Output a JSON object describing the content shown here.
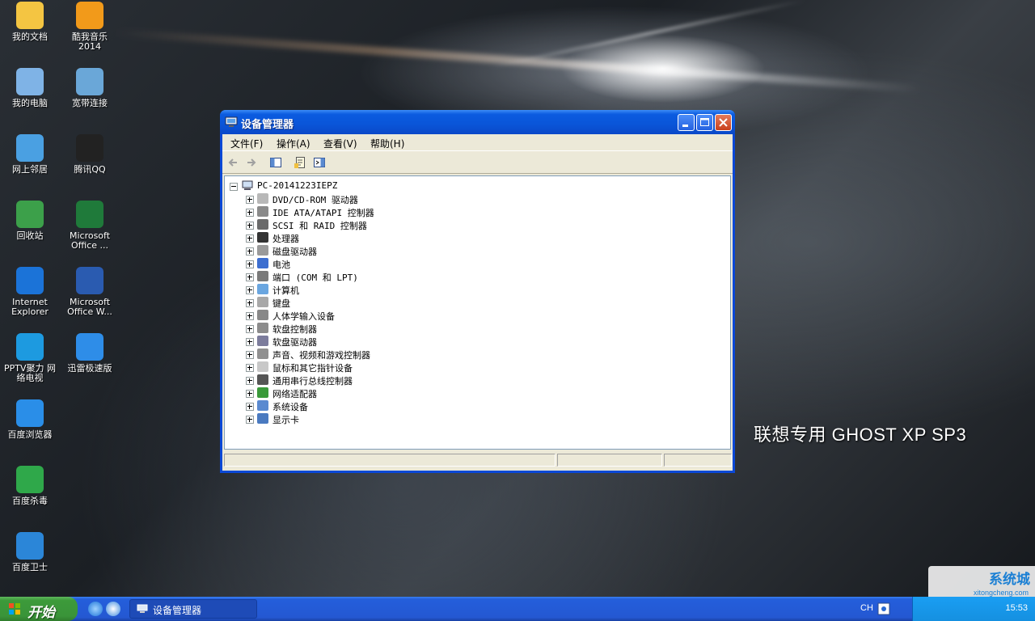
{
  "desktop": {
    "icons": [
      {
        "label": "我的文档",
        "icon": "my-documents-icon",
        "color": "#f4c542"
      },
      {
        "label": "酷我音乐\n2014",
        "icon": "kuwo-music-icon",
        "color": "#f29a1a"
      },
      {
        "label": "我的电脑",
        "icon": "my-computer-icon",
        "color": "#7fb3e6"
      },
      {
        "label": "宽带连接",
        "icon": "broadband-icon",
        "color": "#6aa7d8"
      },
      {
        "label": "网上邻居",
        "icon": "network-places-icon",
        "color": "#4aa0e2"
      },
      {
        "label": "腾讯QQ",
        "icon": "qq-icon",
        "color": "#222222"
      },
      {
        "label": "回收站",
        "icon": "recycle-bin-icon",
        "color": "#3ca04a"
      },
      {
        "label": "Microsoft\nOffice ...",
        "icon": "excel-icon",
        "color": "#1f7a3a"
      },
      {
        "label": "Internet\nExplorer",
        "icon": "ie-icon",
        "color": "#1b73d8"
      },
      {
        "label": "Microsoft\nOffice W...",
        "icon": "word-icon",
        "color": "#2a5bb0"
      },
      {
        "label": "PPTV聚力 网\n络电视",
        "icon": "pptv-icon",
        "color": "#1d9ae0"
      },
      {
        "label": "迅雷极速版",
        "icon": "thunder-icon",
        "color": "#2e8de8"
      },
      {
        "label": "百度浏览器",
        "icon": "baidu-browser-icon",
        "color": "#2a8ee8"
      },
      {
        "label": "百度杀毒",
        "icon": "baidu-antivirus-icon",
        "color": "#2fa84a"
      },
      {
        "label": "百度卫士",
        "icon": "baidu-guard-icon",
        "color": "#2b86d8"
      }
    ],
    "brand_text": "联想专用 GHOST XP SP3",
    "watermark": {
      "line1": "系统城",
      "line2": "xitongcheng.com"
    }
  },
  "window": {
    "title": "设备管理器",
    "menu": [
      "文件(F)",
      "操作(A)",
      "查看(V)",
      "帮助(H)"
    ],
    "root": "PC-20141223IEPZ",
    "devices": [
      {
        "label": "DVD/CD-ROM 驱动器",
        "icon": "dvd-drive-icon",
        "color": "#b8b8b8"
      },
      {
        "label": "IDE ATA/ATAPI 控制器",
        "icon": "ide-controller-icon",
        "color": "#8a8a8a"
      },
      {
        "label": "SCSI 和 RAID 控制器",
        "icon": "scsi-controller-icon",
        "color": "#6a6a6a"
      },
      {
        "label": "处理器",
        "icon": "processor-icon",
        "color": "#333333"
      },
      {
        "label": "磁盘驱动器",
        "icon": "disk-drive-icon",
        "color": "#9a9a9a"
      },
      {
        "label": "电池",
        "icon": "battery-icon",
        "color": "#3c6ed0"
      },
      {
        "label": "端口 (COM 和 LPT)",
        "icon": "port-icon",
        "color": "#7a7a7a"
      },
      {
        "label": "计算机",
        "icon": "computer-icon",
        "color": "#6aa6e0"
      },
      {
        "label": "键盘",
        "icon": "keyboard-icon",
        "color": "#a8a8a8"
      },
      {
        "label": "人体学输入设备",
        "icon": "hid-icon",
        "color": "#888888"
      },
      {
        "label": "软盘控制器",
        "icon": "floppy-controller-icon",
        "color": "#8c8c8c"
      },
      {
        "label": "软盘驱动器",
        "icon": "floppy-drive-icon",
        "color": "#7c7c9c"
      },
      {
        "label": "声音、视频和游戏控制器",
        "icon": "sound-icon",
        "color": "#909090"
      },
      {
        "label": "鼠标和其它指针设备",
        "icon": "mouse-icon",
        "color": "#c8c8c8"
      },
      {
        "label": "通用串行总线控制器",
        "icon": "usb-icon",
        "color": "#555555"
      },
      {
        "label": "网络适配器",
        "icon": "network-adapter-icon",
        "color": "#3a9a3a"
      },
      {
        "label": "系统设备",
        "icon": "system-device-icon",
        "color": "#5a8ad0"
      },
      {
        "label": "显示卡",
        "icon": "display-adapter-icon",
        "color": "#4a7ac0"
      }
    ]
  },
  "taskbar": {
    "start_label": "开始",
    "task_label": "设备管理器",
    "lang": "CH",
    "clock": "15:53"
  }
}
